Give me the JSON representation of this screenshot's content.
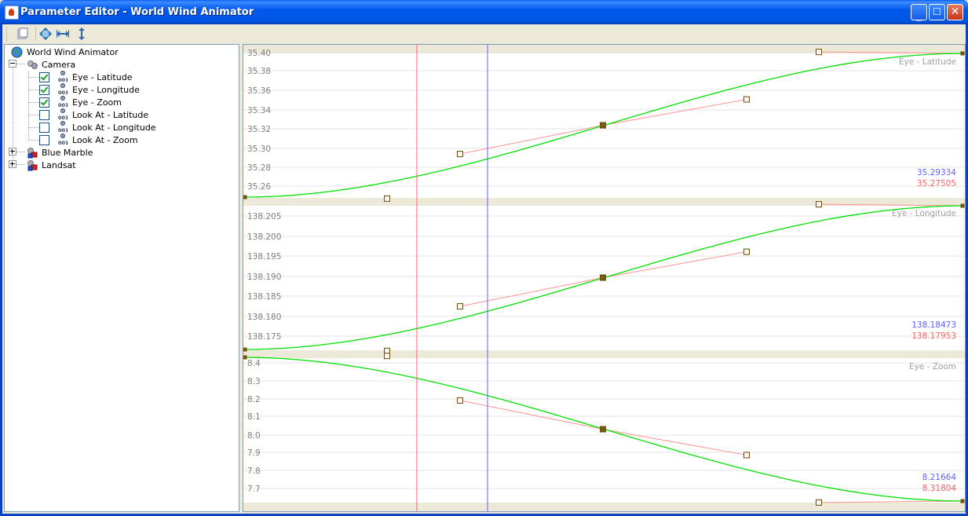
{
  "window": {
    "title": "Parameter Editor - World Wind Animator"
  },
  "toolbar": {
    "buttons": [
      "window-icon",
      "move-icon",
      "fit-horizontal-icon",
      "fit-vertical-icon"
    ]
  },
  "tree": {
    "root": "World Wind Animator",
    "camera": "Camera",
    "params": [
      {
        "label": "Eye - Latitude",
        "checked": true
      },
      {
        "label": "Eye - Longitude",
        "checked": true
      },
      {
        "label": "Eye - Zoom",
        "checked": true
      },
      {
        "label": "Look At - Latitude",
        "checked": false
      },
      {
        "label": "Look At - Longitude",
        "checked": false
      },
      {
        "label": "Look At - Zoom",
        "checked": false
      }
    ],
    "layers": [
      "Blue Marble",
      "Landsat"
    ]
  },
  "colors": {
    "curve": "#00e000",
    "keyline": "#ff9090",
    "cursor_red": "#ff6060",
    "cursor_blue": "#6060ff",
    "panel_band": "#ece9d8"
  },
  "panels": [
    {
      "name": "Eye - Latitude",
      "ticks": [
        "35.40",
        "35.38",
        "35.36",
        "35.34",
        "35.32",
        "35.30",
        "35.28",
        "35.26"
      ],
      "value_blue": "35.29334",
      "value_red": "35.27505"
    },
    {
      "name": "Eye - Longitude",
      "ticks": [
        "138.205",
        "138.200",
        "138.195",
        "138.190",
        "138.185",
        "138.180",
        "138.175"
      ],
      "value_blue": "138.18473",
      "value_red": "138.17953"
    },
    {
      "name": "Eye - Zoom",
      "ticks": [
        "8.4",
        "8.3",
        "8.2",
        "8.1",
        "8.0",
        "7.9",
        "7.8",
        "7.7"
      ],
      "value_blue": "8.21664",
      "value_red": "8.31804"
    }
  ]
}
